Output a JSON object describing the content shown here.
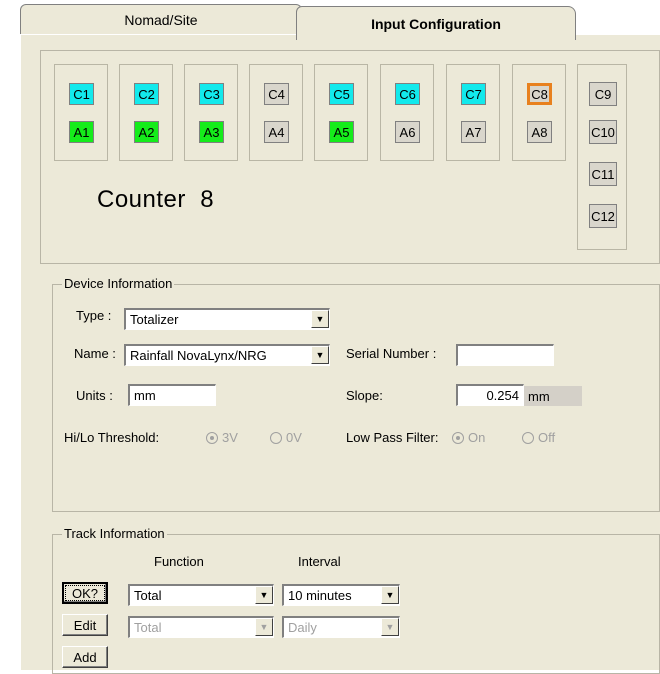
{
  "tabs": [
    {
      "label": "Nomad/Site",
      "active": false
    },
    {
      "label": "Input Configuration",
      "active": true
    }
  ],
  "channels": [
    {
      "top": "C1",
      "bottom": "A1",
      "top_color": "cyan",
      "bottom_color": "green"
    },
    {
      "top": "C2",
      "bottom": "A2",
      "top_color": "cyan",
      "bottom_color": "green"
    },
    {
      "top": "C3",
      "bottom": "A3",
      "top_color": "cyan",
      "bottom_color": "green"
    },
    {
      "top": "C4",
      "bottom": "A4",
      "top_color": "gray",
      "bottom_color": "gray"
    },
    {
      "top": "C5",
      "bottom": "A5",
      "top_color": "cyan",
      "bottom_color": "green"
    },
    {
      "top": "C6",
      "bottom": "A6",
      "top_color": "cyan",
      "bottom_color": "gray"
    },
    {
      "top": "C7",
      "bottom": "A7",
      "top_color": "cyan",
      "bottom_color": "gray"
    },
    {
      "top": "C8",
      "bottom": "A8",
      "top_color": "gray",
      "bottom_color": "gray",
      "selected": "top"
    }
  ],
  "extra_channels": [
    "C9",
    "C10",
    "C11",
    "C12"
  ],
  "selected_label": "Counter  8",
  "device": {
    "title": "Device Information",
    "type_label": "Type :",
    "type_value": "Totalizer",
    "name_label": "Name :",
    "name_value": "Rainfall NovaLynx/NRG",
    "serial_label": "Serial Number :",
    "serial_value": "",
    "units_label": "Units :",
    "units_value": "mm",
    "slope_label": "Slope:",
    "slope_value": "0.254",
    "slope_unit": "mm",
    "threshold_label": "Hi/Lo Threshold:",
    "threshold_options": [
      "3V",
      "0V"
    ],
    "threshold_selected": "3V",
    "filter_label": "Low Pass Filter:",
    "filter_options": [
      "On",
      "Off"
    ],
    "filter_selected": "On"
  },
  "track": {
    "title": "Track Information",
    "function_header": "Function",
    "interval_header": "Interval",
    "rows": [
      {
        "button": "OK?",
        "function": "Total",
        "interval": "10 minutes",
        "enabled": true
      },
      {
        "button": "Edit",
        "function": "Total",
        "interval": "Daily",
        "enabled": false
      },
      {
        "button": "Add"
      }
    ]
  },
  "colors": {
    "cyan": "#12e9ec",
    "green": "#15ec1b",
    "gray": "#d9d6cc",
    "selected_border": "#e8811e",
    "panel": "#ece9d8"
  }
}
